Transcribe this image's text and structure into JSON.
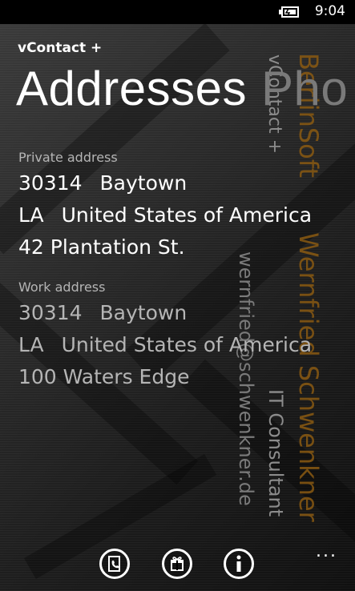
{
  "status": {
    "time": "9:04",
    "battery_icon": "battery-charging-icon"
  },
  "app": {
    "title": "vContact +"
  },
  "pivot": {
    "current": "Addresses",
    "next": "Pho"
  },
  "private_address": {
    "label": "Private address",
    "zip": "30314",
    "city": "Baytown",
    "state": "LA",
    "country": "United States of America",
    "street": "42 Plantation St."
  },
  "work_address": {
    "label": "Work address",
    "zip": "30314",
    "city": "Baytown",
    "state": "LA",
    "country": "United States of America",
    "street": "100 Waters Edge"
  },
  "background_text": {
    "app_name": "vContact +",
    "company": "BerlinSoft",
    "name": "Wernfried Schwenkner",
    "job_title": "IT Consultant",
    "email": "wernfried@schwenkner.de"
  },
  "appbar": {
    "buttons": [
      {
        "icon": "contact-card-icon"
      },
      {
        "icon": "gift-icon"
      },
      {
        "icon": "info-icon"
      }
    ],
    "more": "..."
  },
  "colors": {
    "accent": "#8a5a12",
    "background": "#2a2a2a",
    "secondary_text": "#b5b5b5"
  }
}
